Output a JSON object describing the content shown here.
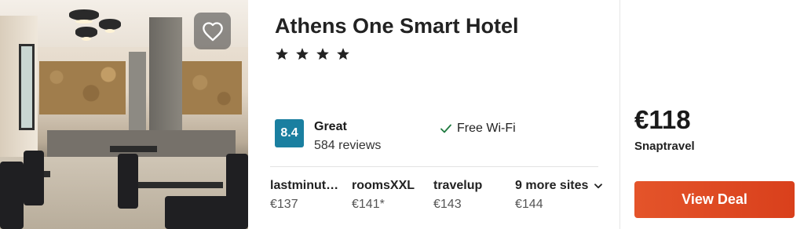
{
  "hotel": {
    "name": "Athens One Smart Hotel",
    "stars": 4
  },
  "rating": {
    "score": "8.4",
    "word": "Great",
    "reviews": "584 reviews",
    "badge_color": "#1a7fa0"
  },
  "amenity": {
    "label": "Free Wi-Fi",
    "icon": "check-icon"
  },
  "sites": [
    {
      "name": "lastminut…",
      "price": "€137"
    },
    {
      "name": "roomsXXL",
      "price": "€141*"
    },
    {
      "name": "travelup",
      "price": "€143"
    }
  ],
  "more_sites": {
    "label": "9 more sites",
    "price": "€144"
  },
  "deal": {
    "price": "€118",
    "provider": "Snaptravel",
    "button_label": "View Deal",
    "button_color": "#e0482a"
  },
  "favorite": {
    "icon": "heart-icon"
  }
}
